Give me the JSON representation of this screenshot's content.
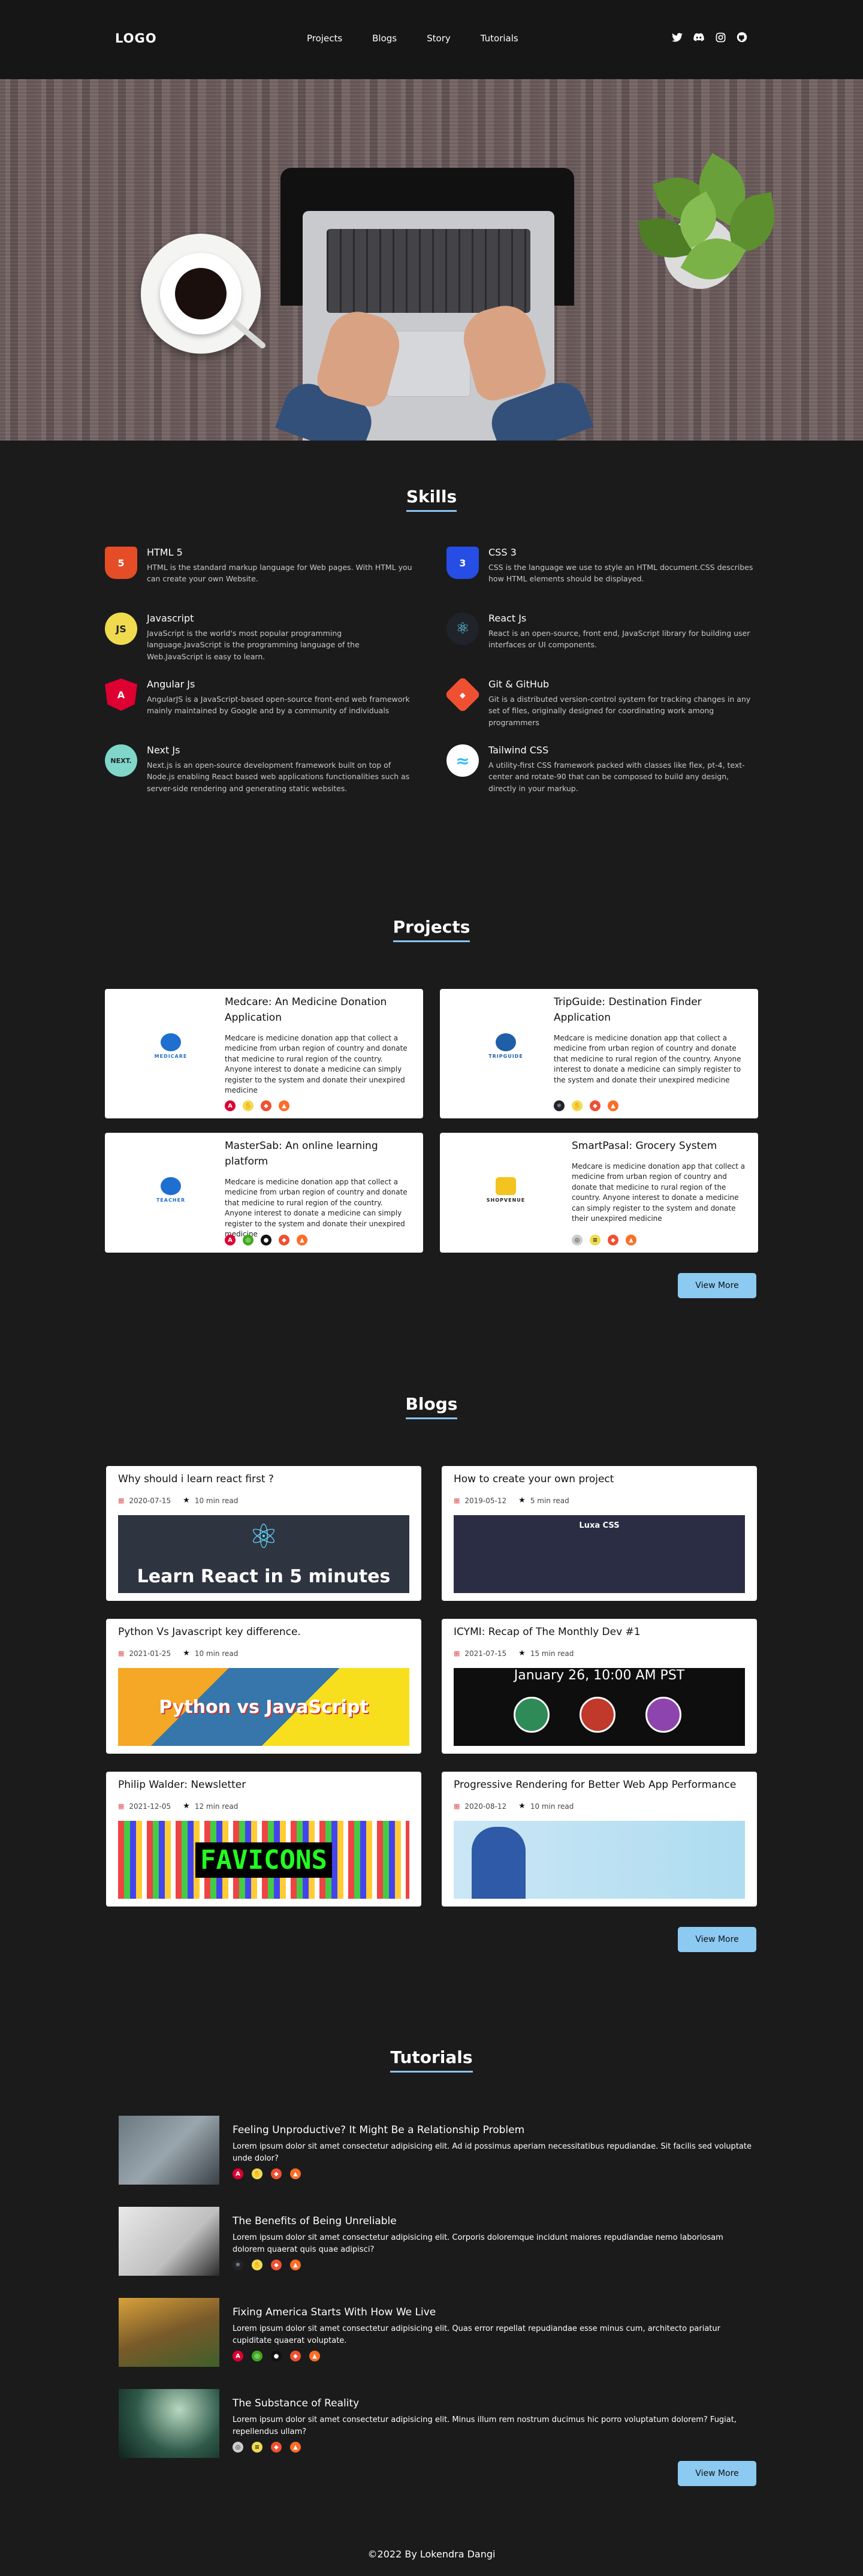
{
  "nav": {
    "logo": "LOGO",
    "links": [
      "Projects",
      "Blogs",
      "Story",
      "Tutorials"
    ],
    "social_icons": [
      "twitter-icon",
      "discord-icon",
      "instagram-icon",
      "github-icon"
    ]
  },
  "skills": {
    "title": "Skills",
    "items": [
      {
        "name": "HTML 5",
        "desc": "HTML is the standard markup language for Web pages. With HTML you can create your own Website.",
        "icon": "html5-icon",
        "color": "#e44d26",
        "glyph": "5"
      },
      {
        "name": "CSS 3",
        "desc": "CSS is the language we use to style an HTML document.CSS describes how HTML elements should be displayed.",
        "icon": "css3-icon",
        "color": "#264de4",
        "glyph": "3"
      },
      {
        "name": "Javascript",
        "desc": "JavaScript is the world's most popular programming language.JavaScript is the programming language of the Web.JavaScript is easy to learn.",
        "icon": "javascript-icon",
        "color": "#f0db4f",
        "glyph": "JS"
      },
      {
        "name": "React Js",
        "desc": "React is an open-source, front end, JavaScript library for building user interfaces or UI components.",
        "icon": "react-icon",
        "color": "#20232a",
        "glyph": "⚛"
      },
      {
        "name": "Angular Js",
        "desc": "AngularJS is a JavaScript-based open-source front-end web framework mainly maintained by Google and by a community of individuals",
        "icon": "angular-icon",
        "color": "#dd0031",
        "glyph": "A"
      },
      {
        "name": "Git & GitHub",
        "desc": "Git is a distributed version-control system for tracking changes in any set of files, originally designed for coordinating work among programmers",
        "icon": "git-icon",
        "color": "#f05032",
        "glyph": "◆"
      },
      {
        "name": "Next Js",
        "desc": "Next.js is an open-source development framework built on top of Node.js enabling React based web applications functionalities such as server-side rendering and generating static websites.",
        "icon": "nextjs-icon",
        "color": "#7fd6c9",
        "glyph": "NEXT."
      },
      {
        "name": "Tailwind CSS",
        "desc": "A utility-first CSS framework packed with classes like flex, pt-4, text-center and rotate-90 that can be composed to build any design, directly in your markup.",
        "icon": "tailwind-icon",
        "color": "#ffffff",
        "glyph": "≈"
      }
    ]
  },
  "projects": {
    "title": "Projects",
    "items": [
      {
        "title": "Medcare: An Medicine Donation Application",
        "desc": "Medcare is medicine donation app that collect a medicine from urban region of country and donate that medicine to rural region of the country. Anyone interest to donate a medicine can simply register to the system and donate their unexpired medicine",
        "logo_text": "MEDICARE",
        "logo_color": "#1f6fd1"
      },
      {
        "title": "TripGuide: Destination Finder Application",
        "desc": "Medcare is medicine donation app that collect a medicine from urban region of country and donate that medicine to rural region of the country. Anyone interest to donate a medicine can simply register to the system and donate their unexpired medicine",
        "logo_text": "TRIPGUIDE",
        "logo_color": "#1f5fa8"
      },
      {
        "title": "MasterSab: An online learning platform",
        "desc": "Medcare is medicine donation app that collect a medicine from urban region of country and donate that medicine to rural region of the country. Anyone interest to donate a medicine can simply register to the system and donate their unexpired medicine",
        "logo_text": "TEACHER",
        "logo_color": "#1f6fd1"
      },
      {
        "title": "SmartPasal: Grocery System",
        "desc": "Medcare is medicine donation app that collect a medicine from urban region of country and donate that medicine to rural region of the country. Anyone interest to donate a medicine can simply register to the system and donate their unexpired medicine",
        "logo_text": "SHOPVENUE",
        "logo_color": "#222222"
      }
    ],
    "view_more": "View More"
  },
  "blogs": {
    "title": "Blogs",
    "items": [
      {
        "title": "Why should i learn react first ?",
        "date": "2020-07-15",
        "read": "10 min read",
        "image_text": "Learn React in 5 minutes"
      },
      {
        "title": "How to create your own project",
        "date": "2019-05-12",
        "read": "5 min read",
        "image_text": "Luxa CSS"
      },
      {
        "title": "Python Vs Javascript key difference.",
        "date": "2021-01-25",
        "read": "10 min read",
        "image_text": "Python vs JavaScript"
      },
      {
        "title": "ICYMI: Recap of The Monthly Dev #1",
        "date": "2021-07-15",
        "read": "15 min read",
        "image_text": "January 26, 10:00 AM PST"
      },
      {
        "title": "Philip Walder: Newsletter",
        "date": "2021-12-05",
        "read": "12 min read",
        "image_text": "FAVICONS"
      },
      {
        "title": "Progressive Rendering for Better Web App Performance",
        "date": "2020-08-12",
        "read": "10 min read",
        "image_text": ""
      }
    ],
    "view_more": "View More"
  },
  "tutorials": {
    "title": "Tutorials",
    "items": [
      {
        "title": "Feeling Unproductive? It Might Be a Relationship Problem",
        "desc": "Lorem ipsum dolor sit amet consectetur adipisicing elit. Ad id possimus aperiam necessitatibus repudiandae. Sit facilis sed voluptate unde dolor?"
      },
      {
        "title": "The Benefits of Being Unreliable",
        "desc": "Lorem ipsum dolor sit amet consectetur adipisicing elit. Corporis doloremque incidunt maiores repudiandae nemo laboriosam dolorem quaerat quis quae adipisci?"
      },
      {
        "title": "Fixing America Starts With How We Live",
        "desc": "Lorem ipsum dolor sit amet consectetur adipisicing elit. Quas error repellat repudiandae esse minus cum, architecto pariatur cupiditate quaerat voluptate."
      },
      {
        "title": "The Substance of Reality",
        "desc": "Lorem ipsum dolor sit amet consectetur adipisicing elit. Minus illum rem nostrum ducimus hic porro voluptatum dolorem? Fugiat, repellendus ullam?"
      }
    ],
    "view_more": "View More"
  },
  "footer": {
    "text": "©2022 By Lokendra Dangi"
  },
  "colors": {
    "background": "#1b1b1c",
    "accent": "#8ccaf2",
    "nav": "#161617"
  }
}
